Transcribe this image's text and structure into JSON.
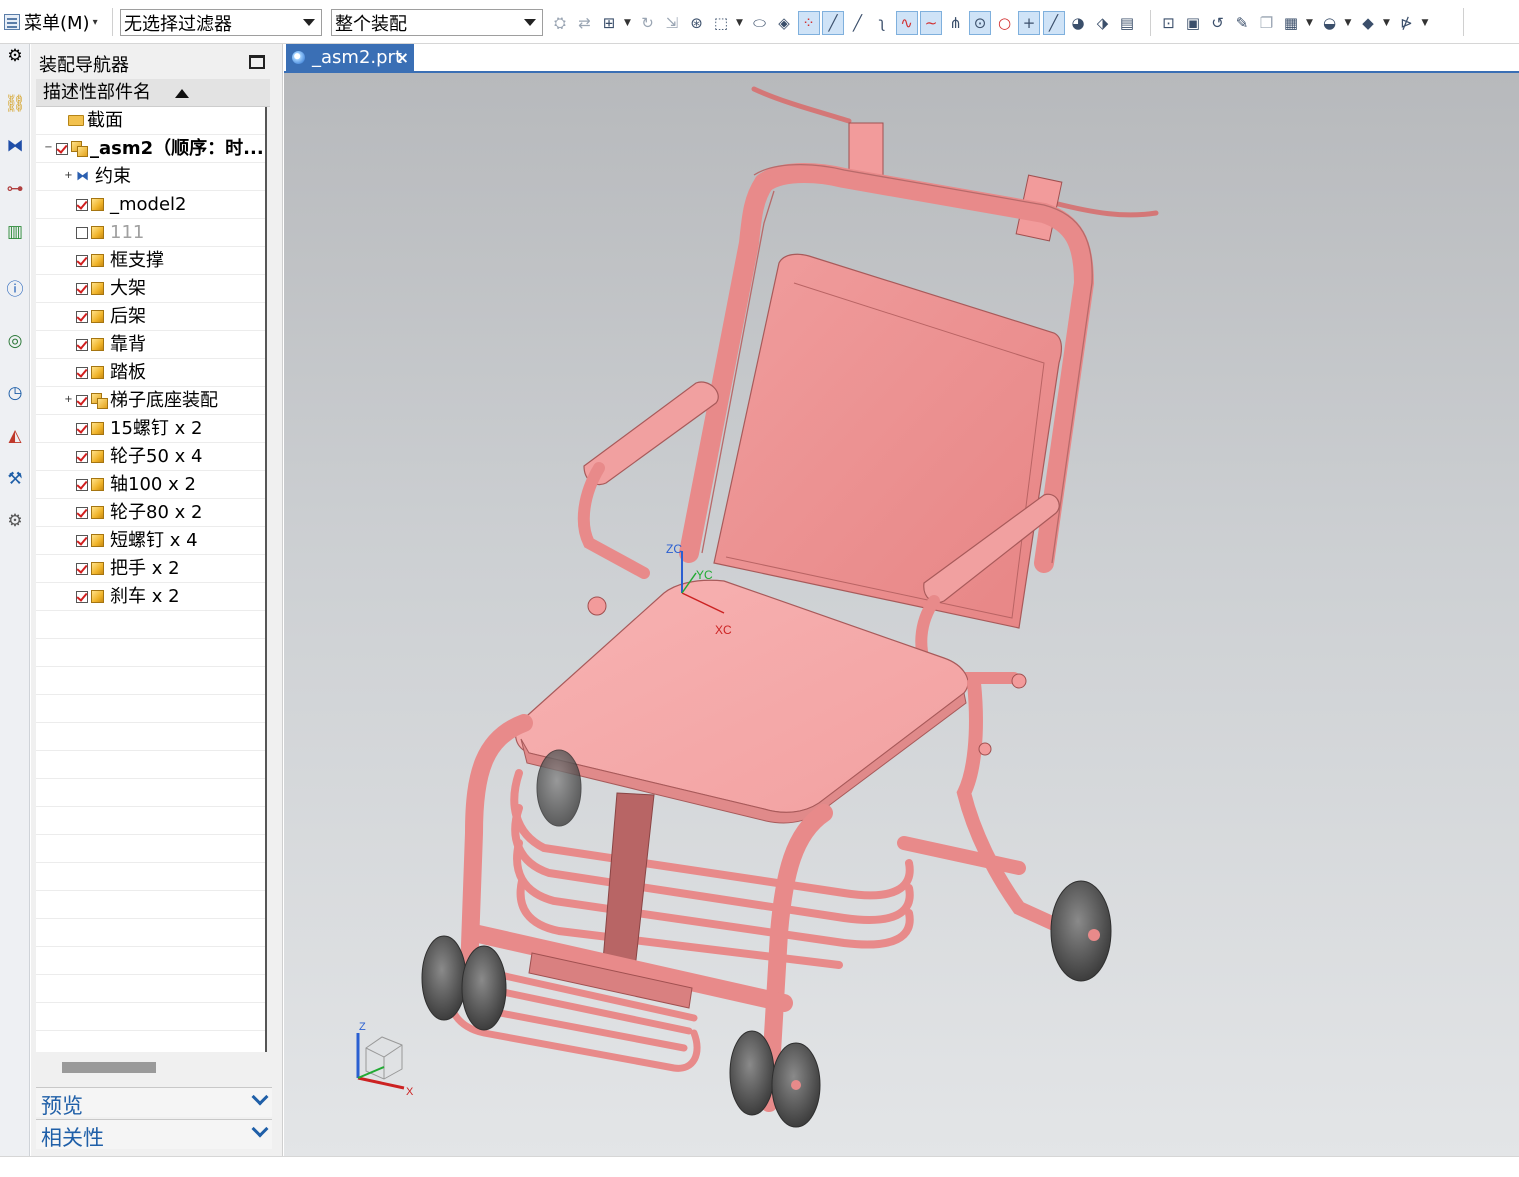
{
  "toolbar": {
    "menu_label": "菜单(M)",
    "filter_value": "无选择过滤器",
    "scope_value": "整个装配",
    "icons": [
      "select-icon",
      "snap-icon",
      "filter-icon",
      "rotate-icon",
      "feature-icon",
      "view-icon",
      "box-select-icon",
      "solid-icon",
      "cube-icon",
      "point-icon",
      "line-icon",
      "curve-icon",
      "spline-icon",
      "arc-icon",
      "wave-icon",
      "tangent-icon",
      "circle-icon",
      "circle-outline-icon",
      "plus-icon",
      "diagonal-icon",
      "surface-icon",
      "sheet-icon",
      "view-fit-icon",
      "camera-icon",
      "refresh-icon",
      "paint-icon",
      "layer-icon",
      "table-icon",
      "shade-icon",
      "render-icon",
      "analysis-icon"
    ]
  },
  "left_strip": {
    "icons": [
      "settings-icon",
      "assembly-navigator-icon",
      "constraint-icon",
      "part-navigator-icon",
      "library-icon",
      "info-icon",
      "web-icon",
      "history-icon",
      "palette-icon",
      "process-icon",
      "robot-icon"
    ]
  },
  "navigator": {
    "title": "装配导航器",
    "column_header": "描述性部件名",
    "rows": [
      {
        "label": "截面",
        "type": "folder",
        "level": 1,
        "checked": null,
        "expander": ""
      },
      {
        "label": "_asm2（顺序：时...",
        "type": "asm",
        "level": 0,
        "checked": true,
        "expander": "−",
        "bold": true
      },
      {
        "label": "约束",
        "type": "constraint",
        "level": 2,
        "checked": null,
        "expander": "+"
      },
      {
        "label": "_model2",
        "type": "part",
        "level": 2,
        "checked": true,
        "expander": ""
      },
      {
        "label": "111",
        "type": "part",
        "level": 2,
        "checked": false,
        "expander": "",
        "gray": true
      },
      {
        "label": "框支撑",
        "type": "part",
        "level": 2,
        "checked": true,
        "expander": ""
      },
      {
        "label": "大架",
        "type": "part",
        "level": 2,
        "checked": true,
        "expander": ""
      },
      {
        "label": "后架",
        "type": "part",
        "level": 2,
        "checked": true,
        "expander": ""
      },
      {
        "label": "靠背",
        "type": "part",
        "level": 2,
        "checked": true,
        "expander": ""
      },
      {
        "label": "踏板",
        "type": "part",
        "level": 2,
        "checked": true,
        "expander": ""
      },
      {
        "label": "梯子底座装配",
        "type": "asm",
        "level": 2,
        "checked": true,
        "expander": "+"
      },
      {
        "label": "15螺钉 x 2",
        "type": "part",
        "level": 2,
        "checked": true,
        "expander": ""
      },
      {
        "label": "轮子50 x 4",
        "type": "part",
        "level": 2,
        "checked": true,
        "expander": ""
      },
      {
        "label": "轴100 x 2",
        "type": "part",
        "level": 2,
        "checked": true,
        "expander": ""
      },
      {
        "label": "轮子80 x 2",
        "type": "part",
        "level": 2,
        "checked": true,
        "expander": ""
      },
      {
        "label": "短螺钉 x 4",
        "type": "part",
        "level": 2,
        "checked": true,
        "expander": ""
      },
      {
        "label": "把手 x 2",
        "type": "part",
        "level": 2,
        "checked": true,
        "expander": ""
      },
      {
        "label": "刹车 x 2",
        "type": "part",
        "level": 2,
        "checked": true,
        "expander": ""
      }
    ],
    "preview_label": "预览",
    "dependency_label": "相关性"
  },
  "tab": {
    "label": "_asm2.prt",
    "close": "×"
  },
  "viewport": {
    "csys_labels": {
      "zc": "ZC",
      "yc": "YC",
      "xc": "XC"
    },
    "triad_labels": {
      "z": "Z",
      "x": "X"
    },
    "colors": {
      "model": "#e98f8f",
      "model_dark": "#b96464",
      "wheel": "#5c5c5c"
    }
  }
}
